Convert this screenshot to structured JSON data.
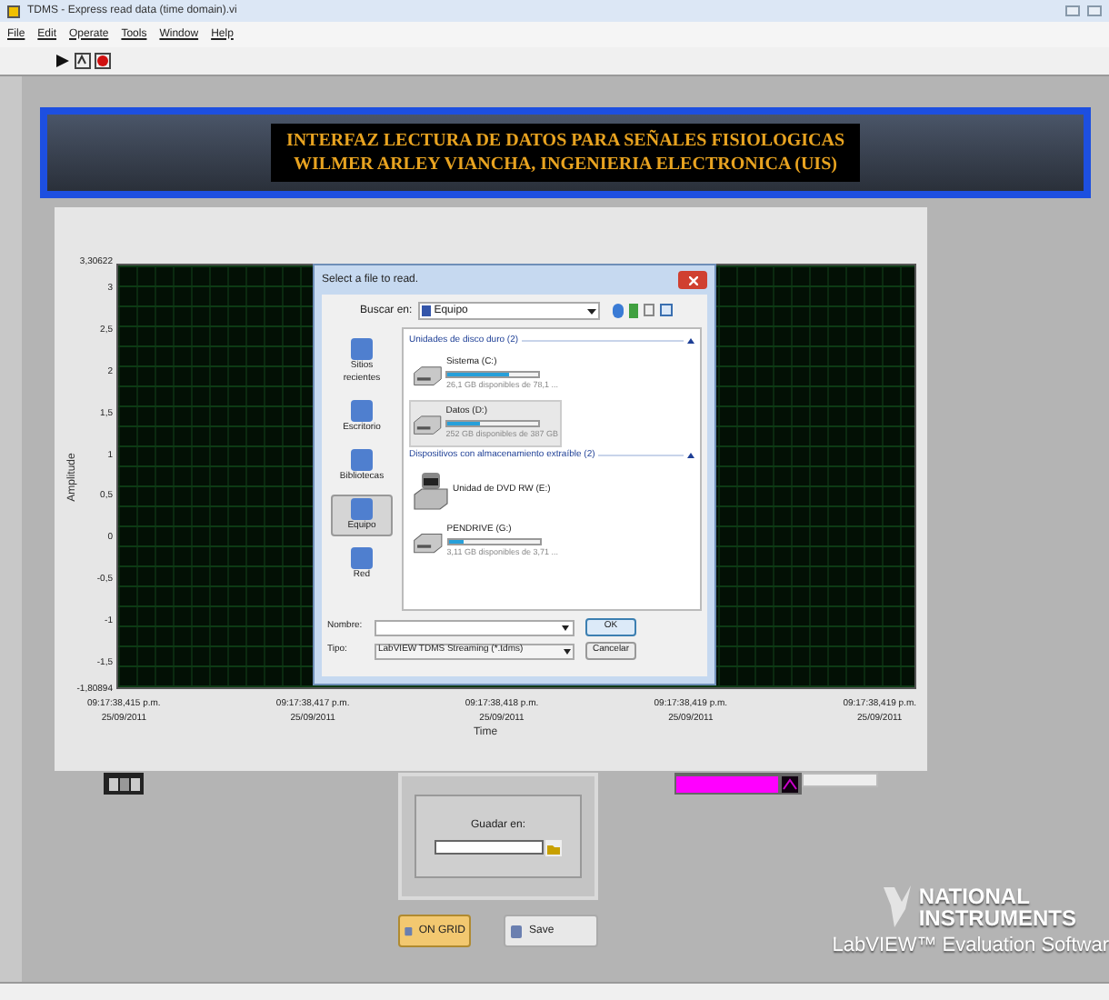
{
  "window": {
    "title": "TDMS - Express read data (time domain).vi"
  },
  "menu": [
    "File",
    "Edit",
    "Operate",
    "Tools",
    "Window",
    "Help"
  ],
  "header": {
    "lines": [
      "INTERFAZ LECTURA DE DATOS PARA SEÑALES FISIOLOGICAS",
      "WILMER ARLEY VIANCHA,  INGENIERIA ELECTRONICA (UIS)"
    ]
  },
  "graph": {
    "ylabel": "Amplitude",
    "xlabel": "Time",
    "y_max": "3,30622",
    "y_min": "-1,80894",
    "yticks": [
      "3",
      "2,5",
      "2",
      "1,5",
      "1",
      "0,5",
      "0",
      "-0,5",
      "-1",
      "-1,5"
    ],
    "xticks": [
      {
        "time": "09:17:38,415 p.m.",
        "date": "25/09/2011"
      },
      {
        "time": "09:17:38,417 p.m.",
        "date": "25/09/2011"
      },
      {
        "time": "09:17:38,418 p.m.",
        "date": "25/09/2011"
      },
      {
        "time": "09:17:38,419 p.m.",
        "date": "25/09/2011"
      },
      {
        "time": "09:17:38,419 p.m.",
        "date": "25/09/2011"
      }
    ]
  },
  "dialog": {
    "title": "Select a file to read.",
    "look_in_label": "Buscar en:",
    "look_in_value": "Equipo",
    "places": [
      {
        "label": "Sitios recientes",
        "selected": false
      },
      {
        "label": "Escritorio",
        "selected": false
      },
      {
        "label": "Bibliotecas",
        "selected": false
      },
      {
        "label": "Equipo",
        "selected": true
      },
      {
        "label": "Red",
        "selected": false
      }
    ],
    "groups": [
      {
        "title": "Unidades de disco duro (2)",
        "items": [
          {
            "kind": "disk",
            "name": "Sistema (C:)",
            "level": 0.67,
            "detail": "26,1 GB disponibles de 78,1 ...",
            "selected": false
          },
          {
            "kind": "disk",
            "name": "Datos (D:)",
            "level": 0.35,
            "detail": "252 GB disponibles de 387 GB",
            "selected": true
          }
        ]
      },
      {
        "title": "Dispositivos con almacenamiento extraíble (2)",
        "items": [
          {
            "kind": "dvd",
            "name": "Unidad de DVD RW (E:)",
            "selected": false
          },
          {
            "kind": "usb",
            "name": "PENDRIVE (G:)",
            "level": 0.16,
            "detail": "3,11 GB disponibles de 3,71 ...",
            "selected": false
          }
        ]
      }
    ],
    "name_label": "Nombre:",
    "type_label": "Tipo:",
    "type_value": "LabVIEW TDMS Streaming (*.tdms)",
    "ok": "OK",
    "cancel": "Cancelar"
  },
  "save_path": {
    "label": "Guadar en:"
  },
  "buttons": [
    {
      "label": "ON GRID",
      "on": true
    },
    {
      "label": "Save",
      "on": false
    }
  ],
  "branding": {
    "lines": [
      "NATIONAL",
      "INSTRUMENTS"
    ],
    "product": "LabVIEW™ Evaluation Softwar"
  }
}
